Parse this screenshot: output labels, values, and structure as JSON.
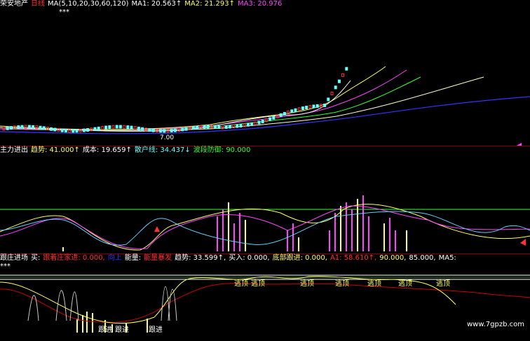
{
  "colors": {
    "bg": "#000000",
    "red": "#ff3333",
    "white": "#ffffff",
    "yellow": "#ffff66",
    "magenta": "#ff44ff",
    "cyan": "#66ffff",
    "green": "#33ff33",
    "blue": "#3333ff",
    "darkred": "#990000"
  },
  "main": {
    "stock_name": "荣安地产",
    "period": "日线",
    "ma_def": "MA(5,10,20,30,60,120)",
    "ma1": "MA1: 20.563↑",
    "ma2": "MA2: 21.293↑",
    "ma3": "MA3: 20.976",
    "low_price": "7.00",
    "stars": "***"
  },
  "sub1": {
    "title": "主力进出",
    "trend": "趋势: 41.000↑",
    "cost": "成本: 19.659↑",
    "retail": "散户线: 34.437↓",
    "band": "波段防御: 90.000"
  },
  "sub2": {
    "title": "跟庄进场",
    "buy": "买:",
    "follow": "跟着庄家进: 0.000,",
    "upward": "向上",
    "energy": "能量:",
    "energy_burst": "能量暴发",
    "trend": "趋势: 33.599↑,",
    "buy_in": "买入: 0.000,",
    "bottom": "底部跟进: 0.000,",
    "a1": "A1: 58.610↑,",
    "v90": "90.000,",
    "v85": "85.000,",
    "ma5": "MA5:",
    "escape_labels": [
      "逃顶",
      "逃顶",
      "逃顶",
      "逃顶",
      "逃顶",
      "逃顶",
      "逃顶"
    ],
    "follow_labels": [
      "跟进",
      "跟进",
      "跟进"
    ],
    "stars": "***"
  },
  "watermark": "www.7gpzb.com"
}
